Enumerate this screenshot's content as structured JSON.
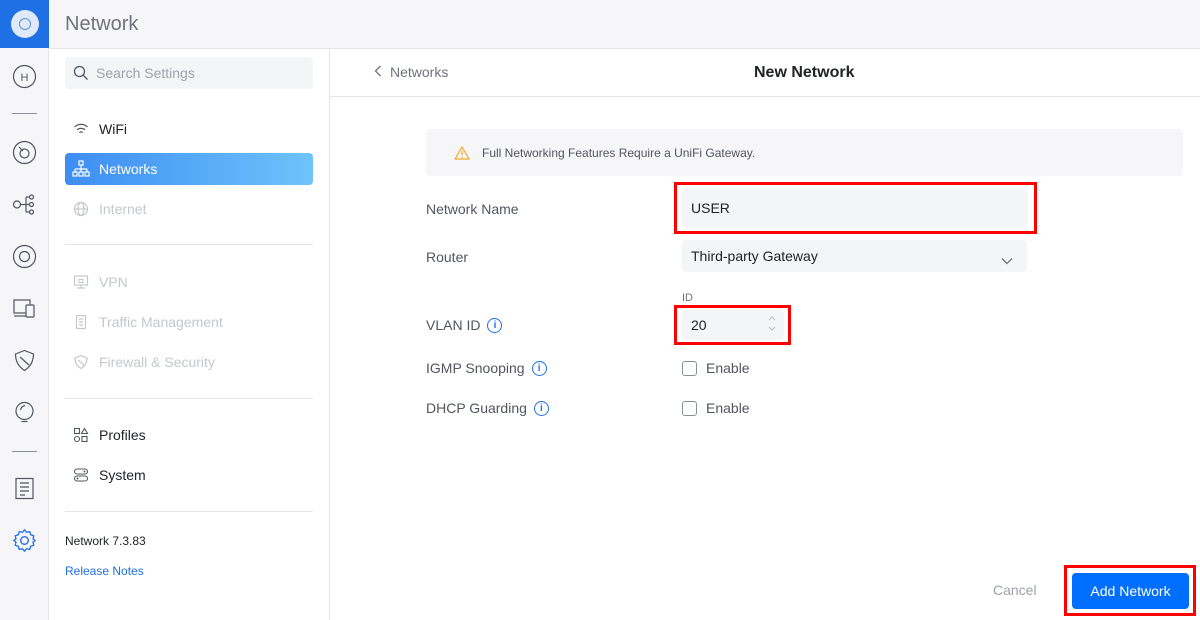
{
  "app": {
    "title": "Network"
  },
  "rail": {
    "home_letter": "H"
  },
  "sidebar": {
    "search_placeholder": "Search Settings",
    "items": [
      {
        "label": "WiFi",
        "icon": "wifi-icon",
        "state": "normal"
      },
      {
        "label": "Networks",
        "icon": "networks-icon",
        "state": "active"
      },
      {
        "label": "Internet",
        "icon": "globe-icon",
        "state": "disabled"
      },
      {
        "label": "VPN",
        "icon": "vpn-icon",
        "state": "disabled"
      },
      {
        "label": "Traffic Management",
        "icon": "traffic-icon",
        "state": "disabled"
      },
      {
        "label": "Firewall & Security",
        "icon": "shield-icon",
        "state": "disabled"
      },
      {
        "label": "Profiles",
        "icon": "profiles-icon",
        "state": "normal"
      },
      {
        "label": "System",
        "icon": "system-icon",
        "state": "normal"
      }
    ],
    "version": "Network 7.3.83",
    "release_notes": "Release Notes"
  },
  "header": {
    "back_label": "Networks",
    "page_title": "New Network"
  },
  "notice": {
    "text": "Full Networking Features Require a UniFi Gateway."
  },
  "form": {
    "network_name": {
      "label": "Network Name",
      "value": "USER"
    },
    "router": {
      "label": "Router",
      "value": "Third-party Gateway"
    },
    "vlan": {
      "label": "VLAN ID",
      "caption": "ID",
      "value": "20",
      "info": "i"
    },
    "igmp": {
      "label": "IGMP Snooping",
      "checkbox_label": "Enable",
      "checked": false,
      "info": "i"
    },
    "dhcp": {
      "label": "DHCP Guarding",
      "checkbox_label": "Enable",
      "checked": false,
      "info": "i"
    }
  },
  "footer": {
    "cancel_label": "Cancel",
    "submit_label": "Add Network"
  },
  "colors": {
    "accent": "#006fff",
    "brand": "#1f6fe5",
    "highlight": "#ff0000",
    "warning": "#f5a623"
  }
}
